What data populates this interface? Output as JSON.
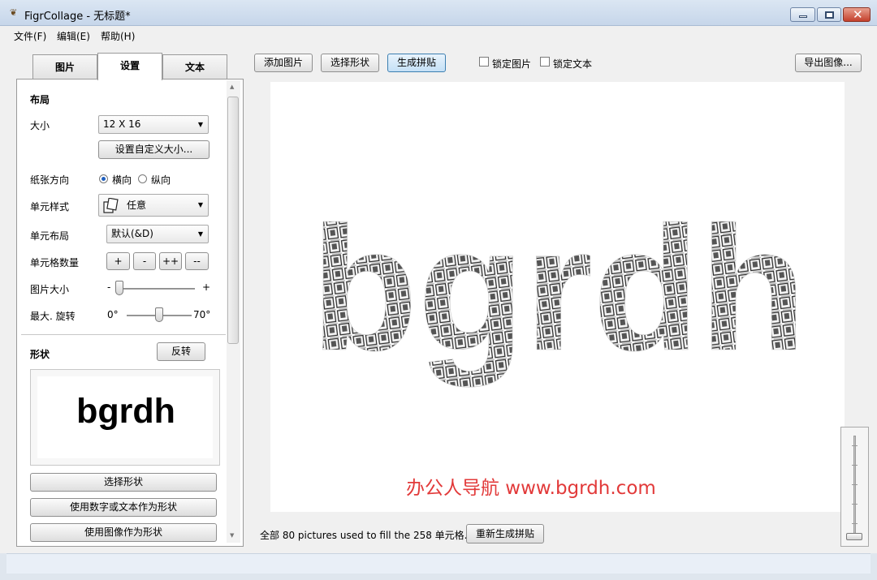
{
  "window": {
    "title": "FigrCollage - 无标题*"
  },
  "menu": [
    "文件(F)",
    "编辑(E)",
    "帮助(H)"
  ],
  "tabs": [
    "图片",
    "设置",
    "文本"
  ],
  "settings": {
    "layout_title": "布局",
    "size_label": "大小",
    "size_value": "12 X 16",
    "custom_size_button": "设置自定义大小...",
    "orientation_label": "纸张方向",
    "orientation_landscape": "横向",
    "orientation_portrait": "纵向",
    "orientation_selected": "横向",
    "cell_style_label": "单元样式",
    "cell_style_value": "任意",
    "cell_layout_label": "单元布局",
    "cell_layout_value": "默认(&D)",
    "cell_count_label": "单元格数量",
    "cell_count_buttons": [
      "+",
      "-",
      "++",
      "--"
    ],
    "image_size_label": "图片大小",
    "image_size_min": "-",
    "image_size_max": "+",
    "max_rotation_label": "最大. 旋转",
    "rotation_min": "0°",
    "rotation_max": "70°"
  },
  "shape": {
    "title": "形状",
    "invert_button": "反转",
    "preview_text": "bgrdh",
    "select_shape_button": "选择形状",
    "use_text_button": "使用数字或文本作为形状",
    "use_image_button": "使用图像作为形状"
  },
  "toolbar": {
    "add_images": "添加图片",
    "select_shape": "选择形状",
    "generate": "生成拼贴",
    "lock_images": "锁定图片",
    "lock_text": "锁定文本",
    "export_image": "导出图像..."
  },
  "canvas": {
    "collage_text": "bgrdh",
    "watermark": "办公人导航 www.bgrdh.com"
  },
  "status": {
    "message": "全部 80 pictures used to fill the 258 单元格.",
    "regenerate_button": "重新生成拼贴"
  },
  "colors": {
    "accent": "#1f5fbf",
    "watermark": "#e23a3a",
    "generate_button_bg": "#d6e8f7"
  },
  "icons": [
    "app-icon",
    "minimize-icon",
    "maximize-icon",
    "close-icon",
    "cell-style-icon",
    "dropdown-arrow-icon"
  ]
}
